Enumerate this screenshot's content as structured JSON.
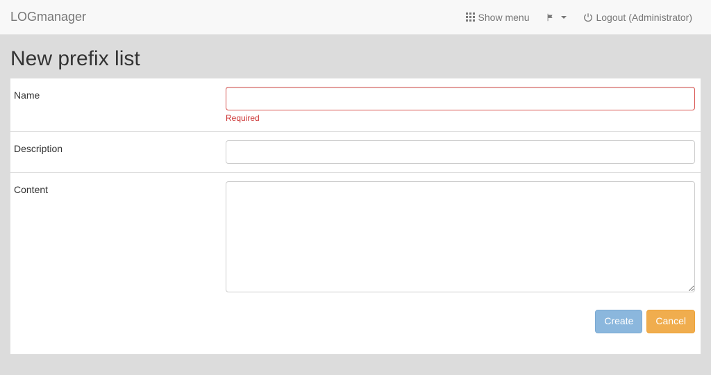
{
  "brand": "LOGmanager",
  "nav": {
    "show_menu": "Show menu",
    "logout_label": "Logout (Administrator)"
  },
  "page": {
    "title": "New prefix list"
  },
  "form": {
    "name": {
      "label": "Name",
      "value": "",
      "error": "Required"
    },
    "description": {
      "label": "Description",
      "value": ""
    },
    "content": {
      "label": "Content",
      "value": ""
    }
  },
  "actions": {
    "create": "Create",
    "cancel": "Cancel"
  }
}
